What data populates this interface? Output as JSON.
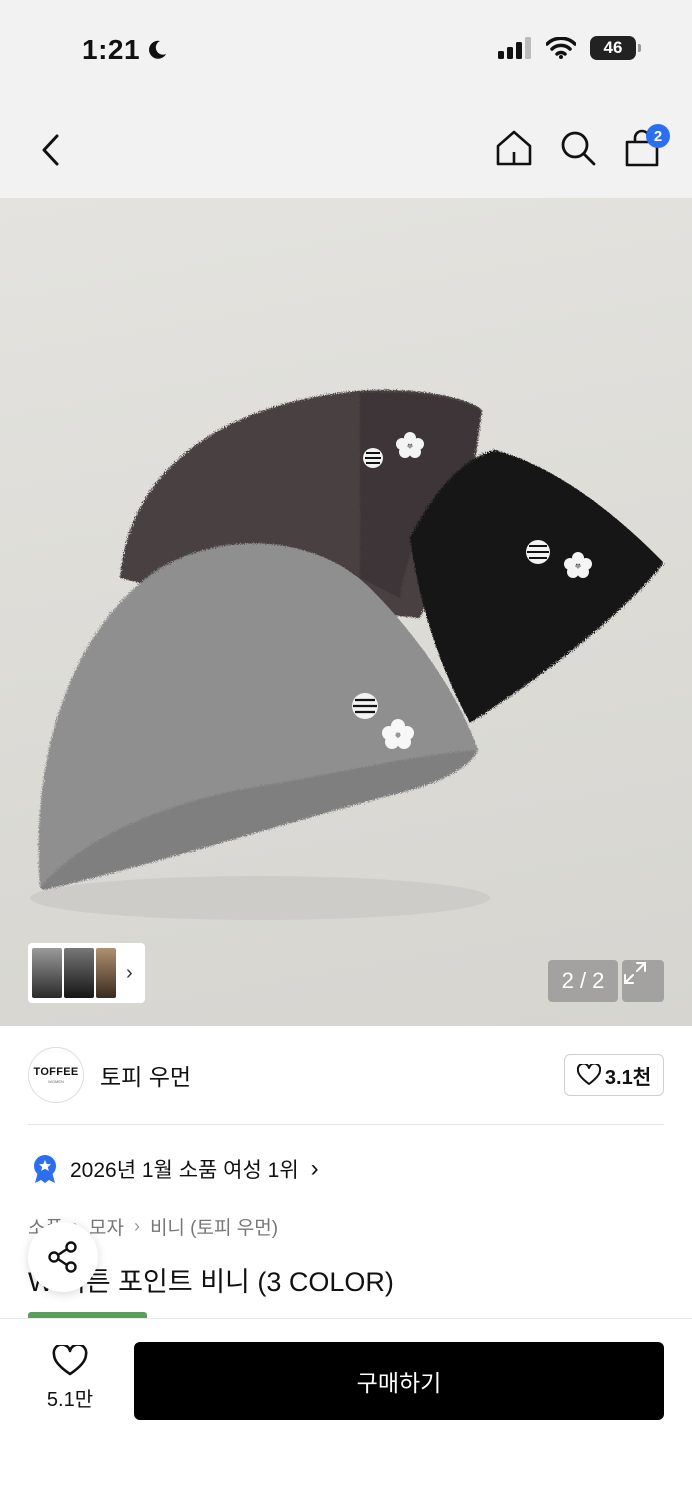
{
  "status": {
    "time": "1:21",
    "battery": "46"
  },
  "nav": {
    "cart_count": "2"
  },
  "gallery": {
    "page_indicator": "2 / 2",
    "thumb_chevron": "›"
  },
  "brand": {
    "logo_text": "TOFFEE",
    "logo_sub": "WOMEN",
    "name": "토피 우먼",
    "likes": "3.1천"
  },
  "ranking": {
    "text": "2026년 1월 소품 여성 1위",
    "chevron": "›"
  },
  "breadcrumb": {
    "items": [
      "소품",
      "모자",
      "비니 (토피 우먼)"
    ],
    "separator": "›"
  },
  "product": {
    "title": "W 버튼 포인트 비니 (3 COLOR)"
  },
  "bottom": {
    "wish_count": "5.1만",
    "buy_label": "구매하기"
  },
  "colors": {
    "accent": "#2b6ff0",
    "tag": "#5a9e5e",
    "buy_button": "#000000"
  }
}
